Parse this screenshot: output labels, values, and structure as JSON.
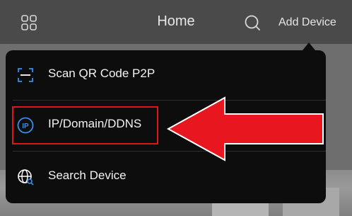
{
  "header": {
    "title": "Home",
    "add_device_label": "Add Device"
  },
  "menu": {
    "items": [
      {
        "label": "Scan QR Code P2P",
        "icon": "scan-qr-icon"
      },
      {
        "label": "IP/Domain/DDNS",
        "icon": "ip-icon",
        "icon_text": "IP"
      },
      {
        "label": "Search Device",
        "icon": "search-device-icon"
      }
    ]
  },
  "colors": {
    "appbar_bg": "#4a4a4a",
    "menu_bg": "#0d0d0d",
    "icon_blue": "#3a8ee6",
    "highlight_red": "#e0141e"
  }
}
